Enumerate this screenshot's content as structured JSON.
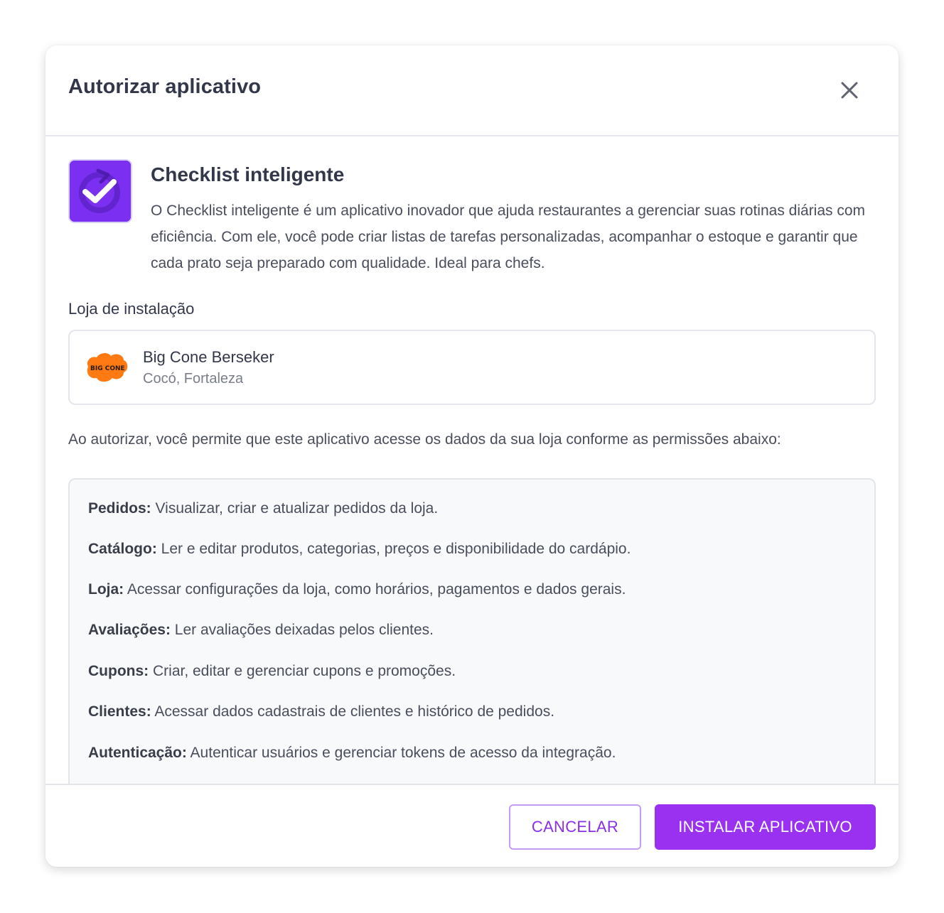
{
  "modal": {
    "title": "Autorizar aplicativo",
    "close_icon": "close-icon"
  },
  "app": {
    "icon": "checklist-check-icon",
    "icon_color": "#7b2ff0",
    "name": "Checklist inteligente",
    "description": "O Checklist inteligente é um aplicativo inovador que ajuda restaurantes a gerenciar suas rotinas diárias com eficiência. Com ele, você pode criar listas de tarefas personalizadas, acompanhar o estoque e garantir que cada prato seja preparado com qualidade. Ideal para chefs."
  },
  "install_store": {
    "label": "Loja de instalação",
    "store": {
      "logo_text": "BIG CONE",
      "name": "Big Cone Berseker",
      "location": "Cocó, Fortaleza"
    }
  },
  "consent": {
    "text": "Ao autorizar, você permite que este aplicativo acesse os dados da sua loja conforme as permissões abaixo:"
  },
  "permissions": [
    {
      "key": "Pedidos:",
      "value": "Visualizar, criar e atualizar pedidos da loja."
    },
    {
      "key": "Catálogo:",
      "value": "Ler e editar produtos, categorias, preços e disponibilidade do cardápio."
    },
    {
      "key": "Loja:",
      "value": "Acessar configurações da loja, como horários, pagamentos e dados gerais."
    },
    {
      "key": "Avaliações:",
      "value": "Ler avaliações deixadas pelos clientes."
    },
    {
      "key": "Cupons:",
      "value": "Criar, editar e gerenciar cupons e promoções."
    },
    {
      "key": "Clientes:",
      "value": "Acessar dados cadastrais de clientes e histórico de pedidos."
    },
    {
      "key": "Autenticação:",
      "value": "Autenticar usuários e gerenciar tokens de acesso da integração."
    }
  ],
  "footer": {
    "cancel_label": "CANCELAR",
    "install_label": "INSTALAR APLICATIVO"
  },
  "colors": {
    "accent": "#9a30f0",
    "accent_border": "#c79cf4"
  }
}
